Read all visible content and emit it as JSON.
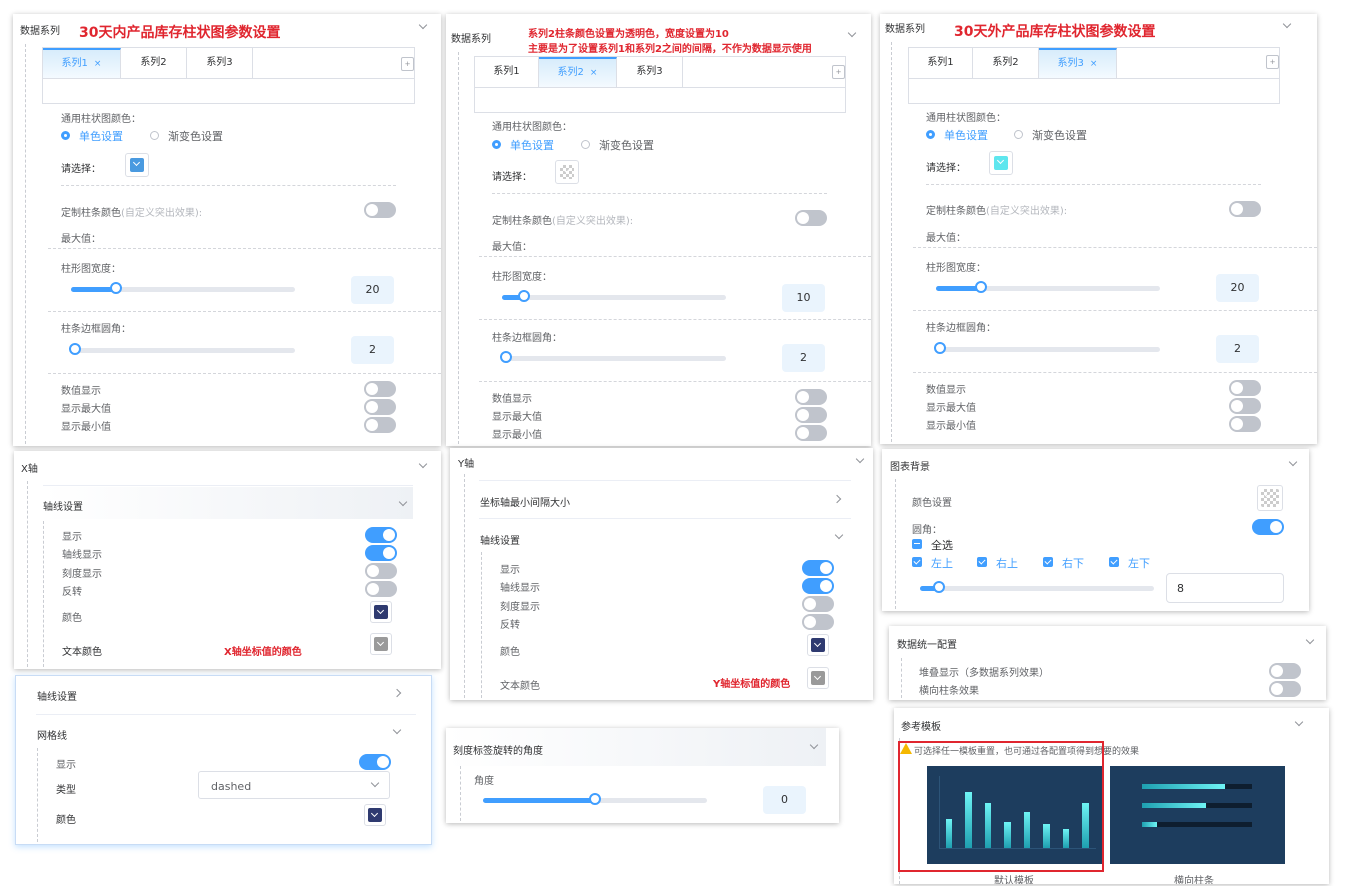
{
  "p1": {
    "title": "数据系列",
    "note": "30天内产品库存柱状图参数设置",
    "tabs": [
      "系列1",
      "系列2",
      "系列3"
    ],
    "tab_close": "×",
    "add": "+",
    "bar_color_label": "通用柱状图颜色：",
    "radio_single": "单色设置",
    "radio_gradient": "渐变色设置",
    "select_label": "请选择：",
    "swatch_color": "#4a9ae0",
    "custom_label": "定制柱条颜色",
    "custom_hint": "(自定义突出效果):",
    "max_label": "最大值：",
    "width_label": "柱形图宽度：",
    "width_value": "20",
    "width_fraction": 0.2,
    "radius_label": "柱条边框圆角：",
    "radius_value": "2",
    "radius_fraction": 0.02,
    "show_value": "数值显示",
    "show_max": "显示最大值",
    "show_min": "显示最小值"
  },
  "p2": {
    "title": "数据系列",
    "note_line1": "系列2柱条颜色设置为透明色，宽度设置为10",
    "note_line2": "主要是为了设置系列1和系列2之间的间隔，不作为数据显示使用",
    "tabs": [
      "系列1",
      "系列2",
      "系列3"
    ],
    "tab_close": "×",
    "add": "+",
    "bar_color_label": "通用柱状图颜色：",
    "radio_single": "单色设置",
    "radio_gradient": "渐变色设置",
    "select_label": "请选择：",
    "custom_label": "定制柱条颜色",
    "custom_hint": "(自定义突出效果):",
    "max_label": "最大值：",
    "width_label": "柱形图宽度：",
    "width_value": "10",
    "width_fraction": 0.1,
    "radius_label": "柱条边框圆角：",
    "radius_value": "2",
    "radius_fraction": 0.02,
    "show_value": "数值显示",
    "show_max": "显示最大值",
    "show_min": "显示最小值"
  },
  "p3": {
    "title": "数据系列",
    "note": "30天外产品库存柱状图参数设置",
    "tabs": [
      "系列1",
      "系列2",
      "系列3"
    ],
    "tab_close": "×",
    "add": "+",
    "bar_color_label": "通用柱状图颜色：",
    "radio_single": "单色设置",
    "radio_gradient": "渐变色设置",
    "select_label": "请选择：",
    "swatch_color": "#5ee6ee",
    "custom_label": "定制柱条颜色",
    "custom_hint": "(自定义突出效果):",
    "max_label": "最大值：",
    "width_label": "柱形图宽度：",
    "width_value": "20",
    "width_fraction": 0.2,
    "radius_label": "柱条边框圆角：",
    "radius_value": "2",
    "radius_fraction": 0.02,
    "show_value": "数值显示",
    "show_max": "显示最大值",
    "show_min": "显示最小值"
  },
  "xaxis": {
    "title": "X轴",
    "axis_settings": "轴线设置",
    "show": "显示",
    "axis_line": "轴线显示",
    "tick_show": "刻度显示",
    "reverse": "反转",
    "color": "颜色",
    "text_color": "文本颜色",
    "note": "X轴坐标值的颜色",
    "color_value": "#2f3a70",
    "text_color_value": "#9a9a9a"
  },
  "grid": {
    "axis_settings": "轴线设置",
    "gridline": "网格线",
    "show": "显示",
    "type_label": "类型",
    "type_value": "dashed",
    "color_label": "颜色",
    "color_value": "#2f3a70"
  },
  "yaxis": {
    "title": "Y轴",
    "min_interval": "坐标轴最小间隔大小",
    "axis_settings": "轴线设置",
    "show": "显示",
    "axis_line": "轴线显示",
    "tick_show": "刻度显示",
    "reverse": "反转",
    "color": "颜色",
    "text_color": "文本颜色",
    "note": "Y轴坐标值的颜色",
    "color_value": "#2f3a70",
    "text_color_value": "#9a9a9a"
  },
  "rotate": {
    "title": "刻度标签旋转的角度",
    "angle_label": "角度",
    "angle_value": "0",
    "angle_fraction": 0.5
  },
  "bg": {
    "title": "图表背景",
    "color_setting": "颜色设置",
    "radius": "圆角：",
    "select_all": "全选",
    "corners": [
      "左上",
      "右上",
      "右下",
      "左下"
    ],
    "radius_value": "8",
    "radius_fraction": 0.08
  },
  "unified": {
    "title": "数据统一配置",
    "stack": "堆叠显示（多数据系列效果）",
    "horizontal": "横向柱条效果"
  },
  "template": {
    "title": "参考模板",
    "hint": "可选择任一模板重置，也可通过各配置项得到想要的效果",
    "default_name": "默认模板",
    "horizontal_name": "横向柱条",
    "thumb_bars": [
      0.4,
      0.78,
      0.62,
      0.36,
      0.5,
      0.34,
      0.27,
      0.63
    ],
    "thumb_hbars": [
      0.75,
      0.58,
      0.14
    ]
  }
}
